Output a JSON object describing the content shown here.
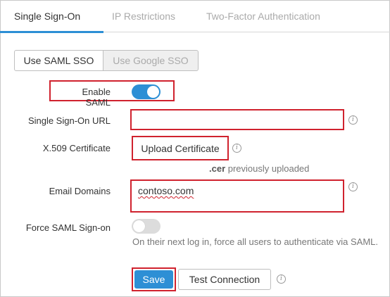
{
  "tabs": {
    "sso": "Single Sign-On",
    "ip": "IP Restrictions",
    "twofa": "Two-Factor Authentication"
  },
  "mode": {
    "saml": "Use SAML SSO",
    "google": "Use Google SSO"
  },
  "form": {
    "enable_saml_label": "Enable SAML",
    "enable_saml_on": true,
    "sso_url_label": "Single Sign-On URL",
    "sso_url_value": "",
    "cert_label": "X.509 Certificate",
    "cert_button": "Upload Certificate",
    "cert_ext": ".cer",
    "cert_status": " previously uploaded",
    "email_domains_label": "Email Domains",
    "email_domains_value": "contoso.com",
    "force_label": "Force SAML Sign-on",
    "force_on": false,
    "force_hint": "On their next log in, force all users to authenticate via SAML."
  },
  "actions": {
    "save": "Save",
    "test": "Test Connection"
  },
  "colors": {
    "accent": "#2d8fd5",
    "highlight": "#d0222e"
  }
}
